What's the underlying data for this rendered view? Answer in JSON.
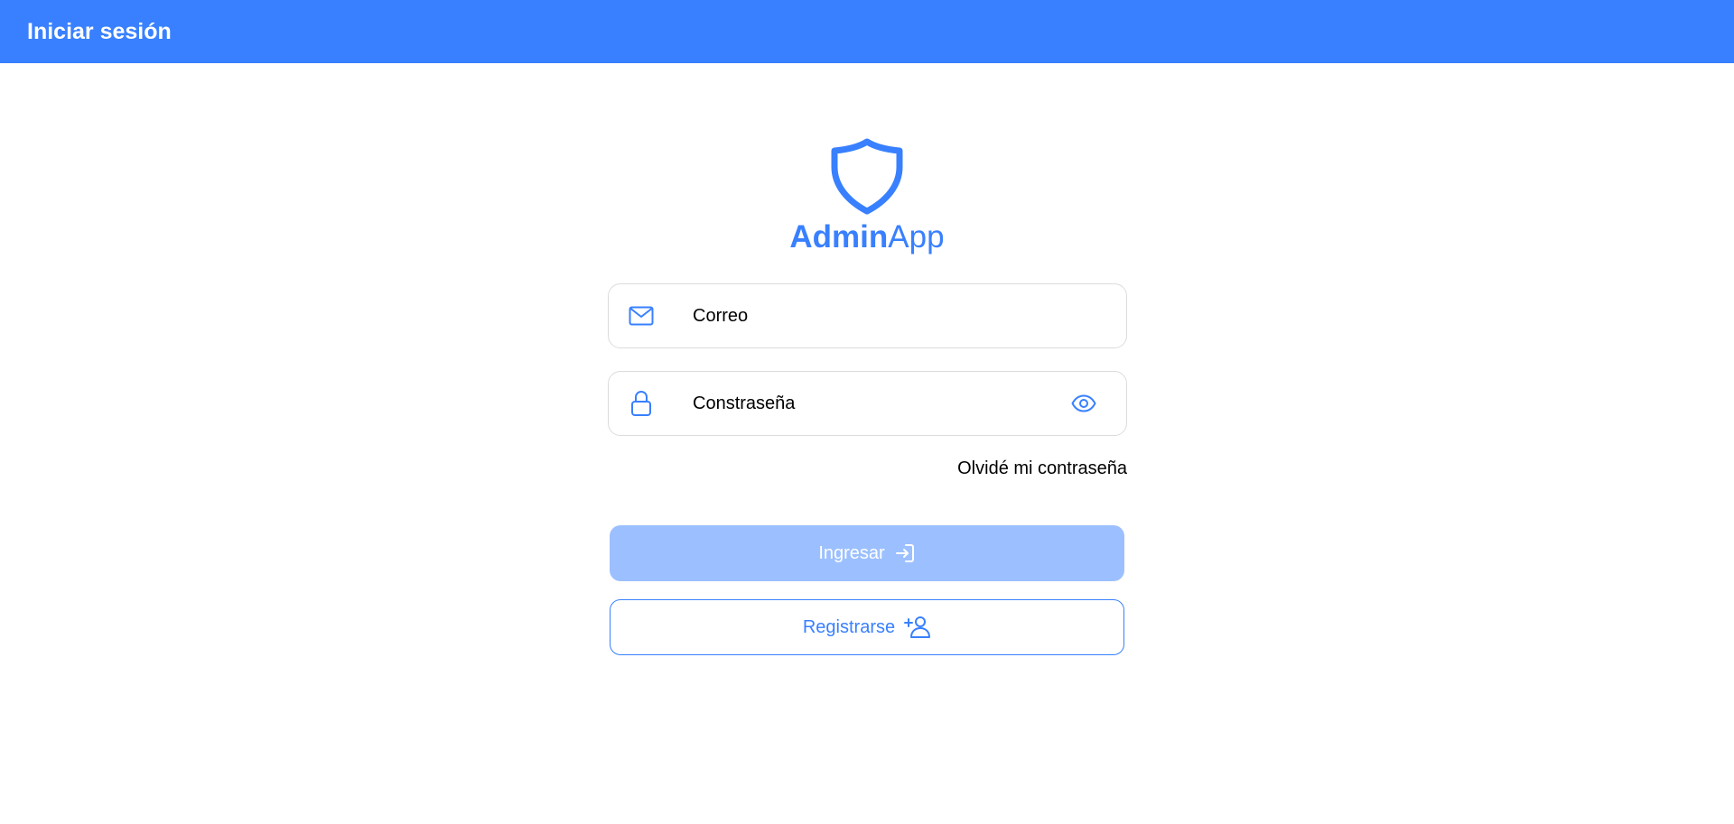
{
  "header": {
    "title": "Iniciar sesión"
  },
  "brand": {
    "name_strong": "Admin",
    "name_light": "App",
    "logo_icon": "shield-icon"
  },
  "form": {
    "email": {
      "placeholder": "Correo",
      "value": "",
      "icon": "mail-icon"
    },
    "password": {
      "placeholder": "Constraseña",
      "value": "",
      "icon": "lock-icon",
      "toggle_icon": "eye-icon"
    },
    "forgot_label": "Olvidé mi contraseña",
    "login_label": "Ingresar",
    "login_icon": "log-in-icon",
    "register_label": "Registrarse",
    "register_icon": "add-user-icon"
  },
  "colors": {
    "primary": "#3880ff",
    "primary_disabled": "#9cc0ff",
    "border": "#dcdcdc"
  }
}
